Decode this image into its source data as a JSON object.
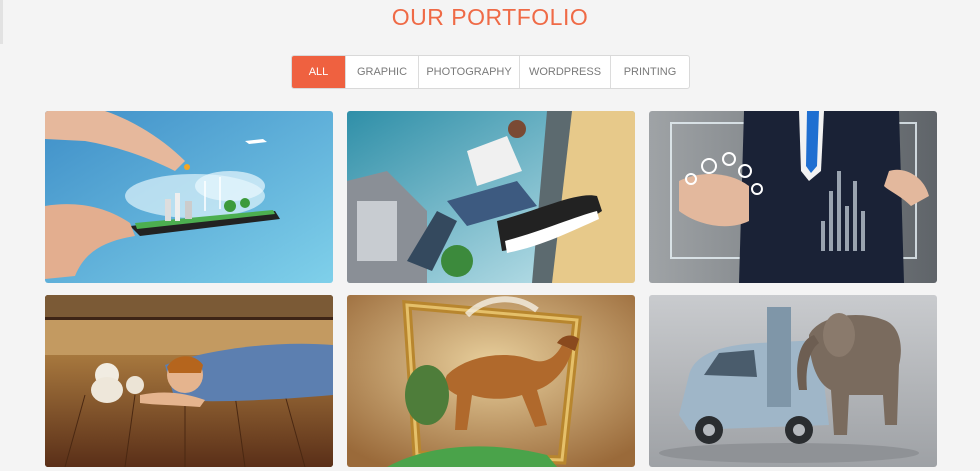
{
  "section": {
    "title": "OUR PORTFOLIO"
  },
  "filters": [
    {
      "label": "ALL",
      "active": true
    },
    {
      "label": "GRAPHIC",
      "active": false
    },
    {
      "label": "PHOTOGRAPHY",
      "active": false
    },
    {
      "label": "WORDPRESS",
      "active": false
    },
    {
      "label": "PRINTING",
      "active": false
    }
  ],
  "colors": {
    "accent": "#ef6140",
    "title": "#ef6a46",
    "background": "#f4f4f4"
  },
  "portfolio_items": [
    {
      "image": "hands-tablet-eco-city"
    },
    {
      "image": "man-running-out-of-wall"
    },
    {
      "image": "businessman-touchscreen-chart"
    },
    {
      "image": "child-under-floor-teddy-bears"
    },
    {
      "image": "horse-leaping-from-frame"
    },
    {
      "image": "elephant-in-van"
    }
  ]
}
